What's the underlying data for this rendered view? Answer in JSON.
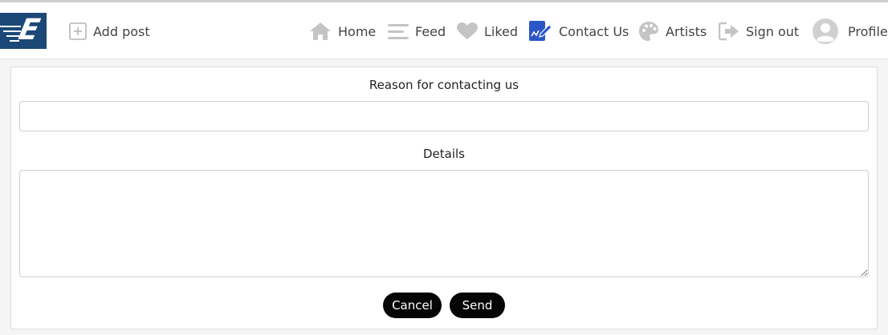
{
  "nav": {
    "add_post": "Add post",
    "home": "Home",
    "feed": "Feed",
    "liked": "Liked",
    "contact_us": "Contact Us",
    "artists": "Artists",
    "sign_out": "Sign out",
    "profile": "Profile"
  },
  "brand": {
    "logo_letter": "E",
    "logo_color": "#1c4877"
  },
  "form": {
    "reason_label": "Reason for contacting us",
    "reason_value": "",
    "details_label": "Details",
    "details_value": "",
    "cancel_label": "Cancel",
    "send_label": "Send"
  },
  "colors": {
    "icon_gray": "#c4c4c4",
    "contact_icon_blue": "#2a56c6",
    "button_bg": "#050505",
    "button_text": "#ffffff"
  },
  "icons": [
    "plus-square-icon",
    "home-icon",
    "menu-lines-icon",
    "heart-icon",
    "contact-edit-icon",
    "palette-icon",
    "sign-out-icon",
    "user-avatar-icon"
  ]
}
